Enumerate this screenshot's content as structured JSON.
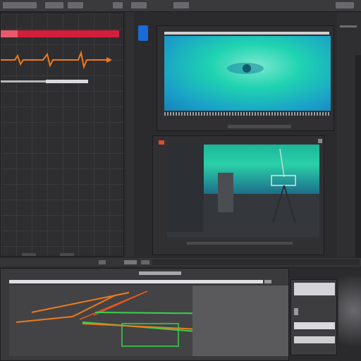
{
  "menu": {
    "items": [
      "",
      "",
      "",
      "",
      "",
      "",
      ""
    ]
  },
  "timeline": {
    "track_label": "",
    "readout": ""
  },
  "viewer_top": {
    "caption": ""
  },
  "viewer_bottom": {
    "caption": ""
  },
  "bottom_panel": {
    "header": ""
  },
  "colors": {
    "accent_red": "#d21f3c",
    "accent_orange": "#f07a1a",
    "accent_green": "#3ad24a",
    "viewer_teal": "#1fd3b0"
  },
  "icons": {
    "app": "blue-app-icon"
  }
}
